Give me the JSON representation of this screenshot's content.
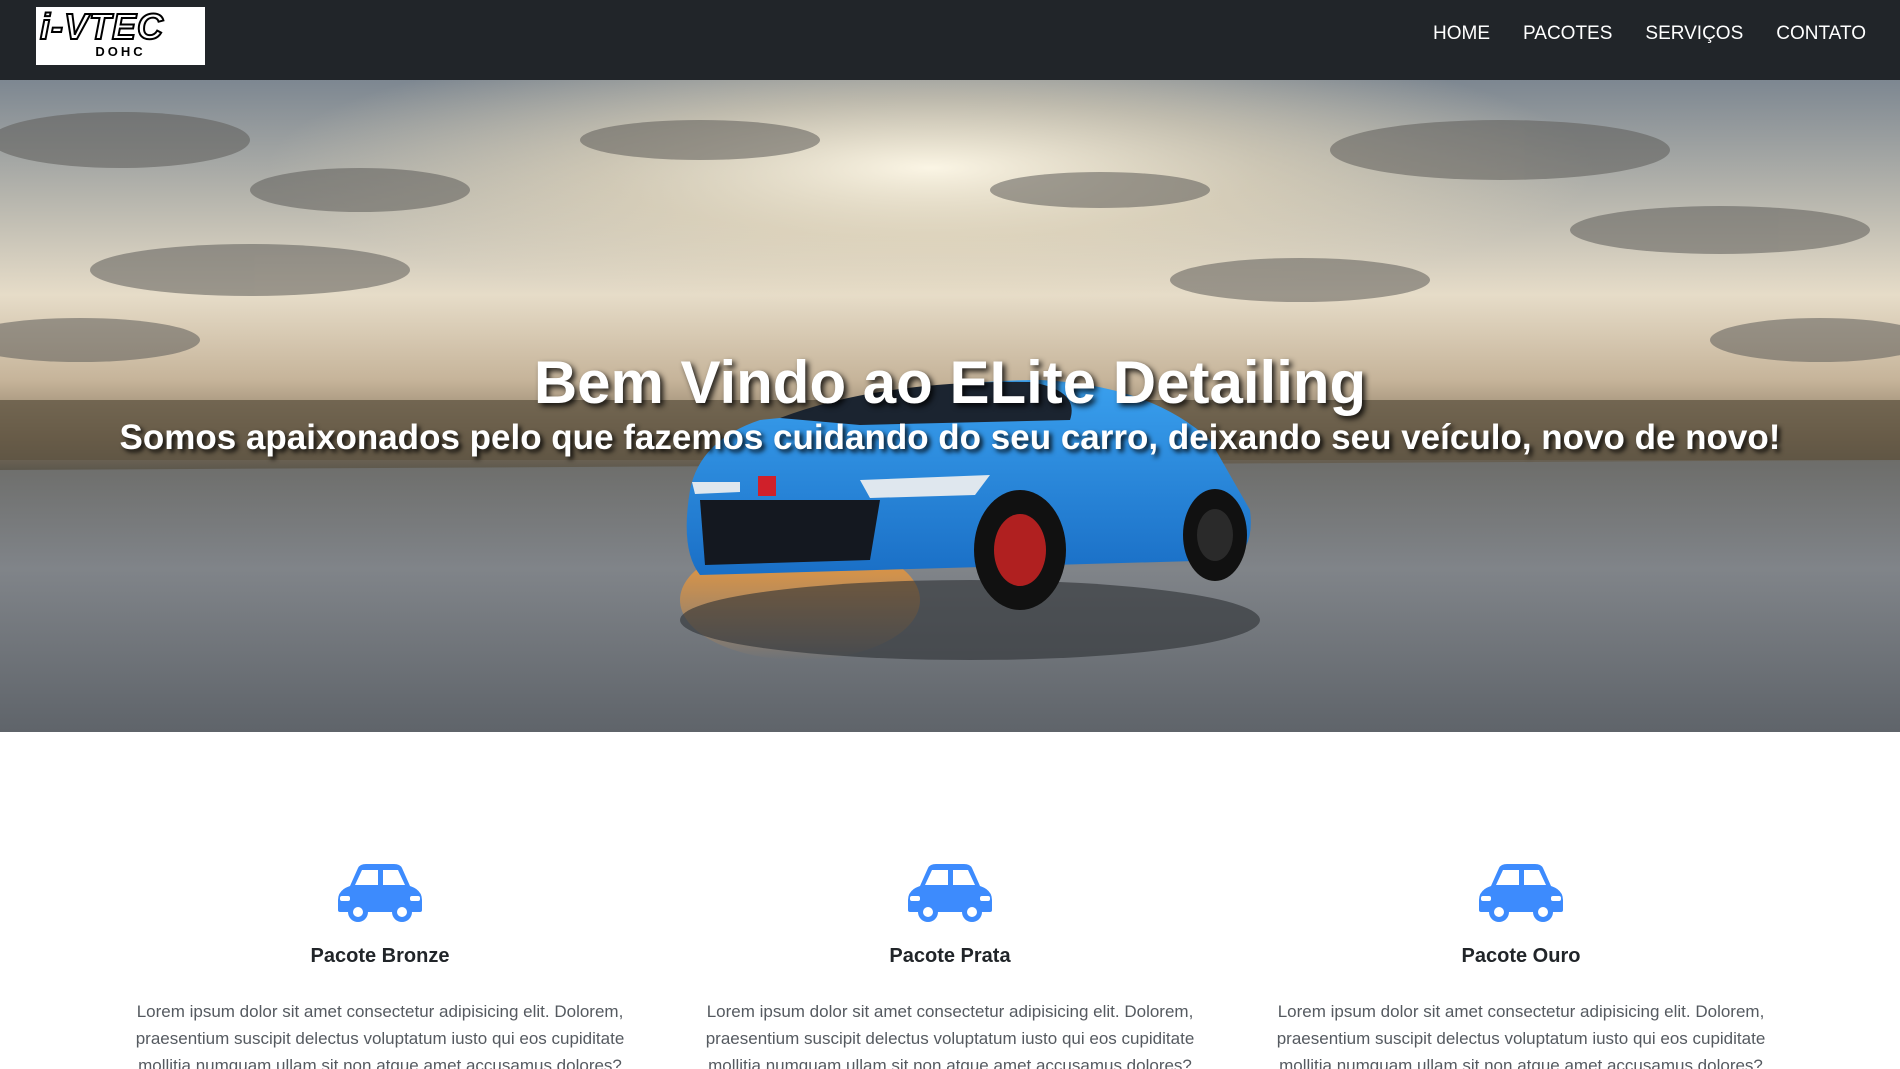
{
  "brand": {
    "logo_main": "i-VTEC",
    "logo_sub": "DOHC"
  },
  "nav": {
    "items": [
      {
        "label": "HOME"
      },
      {
        "label": "PACOTES"
      },
      {
        "label": "SERVIÇOS"
      },
      {
        "label": "CONTATO"
      }
    ]
  },
  "hero": {
    "title": "Bem Vindo ao ELite Detailing",
    "subtitle": "Somos apaixonados pelo que fazemos cuidando do seu carro, deixando seu veículo, novo de novo!",
    "image_icon": "blue-hatchback-car-on-road-at-sunset"
  },
  "packages": {
    "icon": "car-icon",
    "icon_color": "#3d8bfd",
    "items": [
      {
        "title": "Pacote Bronze",
        "text": "Lorem ipsum dolor sit amet consectetur adipisicing elit. Dolorem, praesentium suscipit delectus voluptatum iusto qui eos cupiditate mollitia numquam ullam sit non atque amet accusamus dolores?"
      },
      {
        "title": "Pacote Prata",
        "text": "Lorem ipsum dolor sit amet consectetur adipisicing elit. Dolorem, praesentium suscipit delectus voluptatum iusto qui eos cupiditate mollitia numquam ullam sit non atque amet accusamus dolores?"
      },
      {
        "title": "Pacote Ouro",
        "text": "Lorem ipsum dolor sit amet consectetur adipisicing elit. Dolorem, praesentium suscipit delectus voluptatum iusto qui eos cupiditate mollitia numquam ullam sit non atque amet accusamus dolores?"
      }
    ]
  },
  "colors": {
    "navbar": "#212529",
    "accent": "#3d8bfd",
    "car_body": "#1f7fd9"
  }
}
